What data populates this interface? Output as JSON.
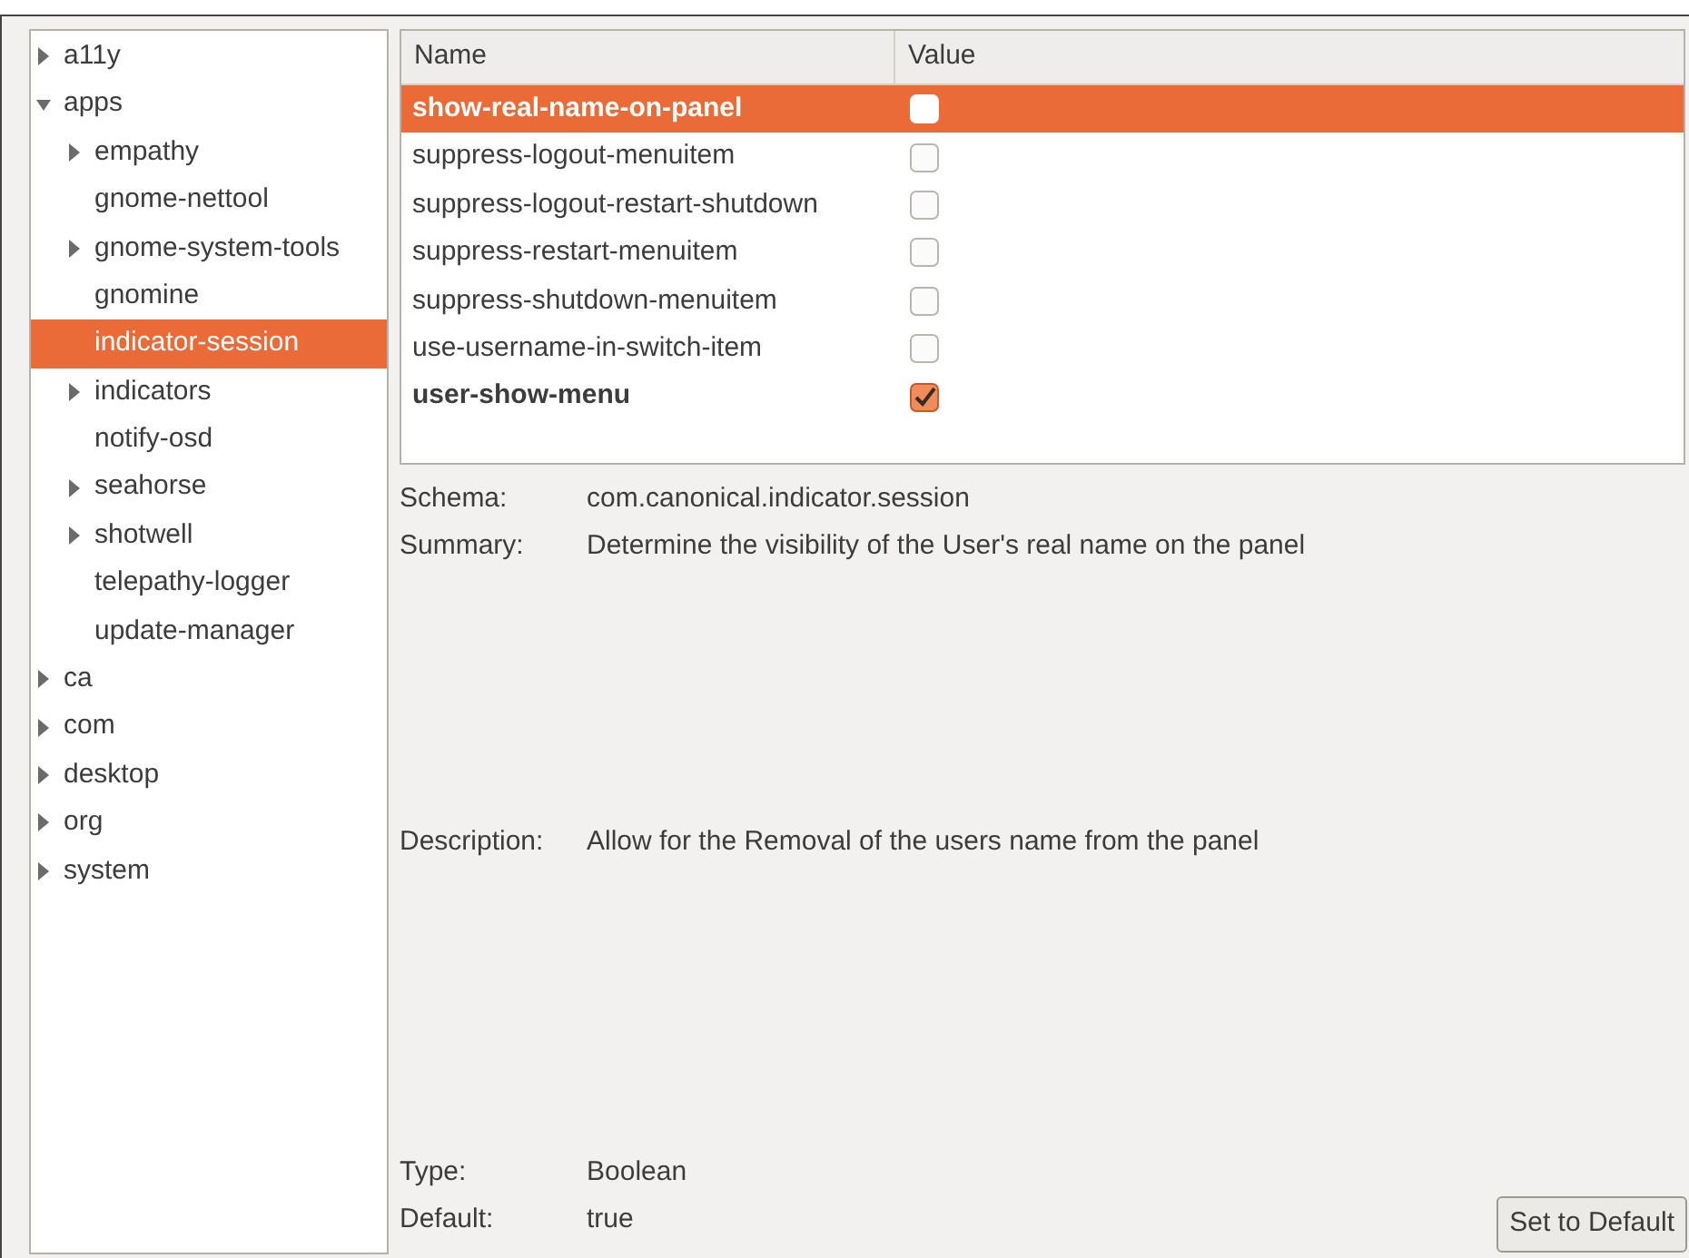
{
  "tree": [
    {
      "label": "a11y",
      "kind": "branch",
      "expanded": false,
      "selected": false
    },
    {
      "label": "apps",
      "kind": "branch",
      "expanded": true,
      "selected": false,
      "children": [
        {
          "label": "empathy",
          "kind": "branch",
          "expanded": false,
          "selected": false
        },
        {
          "label": "gnome-nettool",
          "kind": "leaf",
          "selected": false
        },
        {
          "label": "gnome-system-tools",
          "kind": "branch",
          "expanded": false,
          "selected": false
        },
        {
          "label": "gnomine",
          "kind": "leaf",
          "selected": false
        },
        {
          "label": "indicator-session",
          "kind": "leaf",
          "selected": true
        },
        {
          "label": "indicators",
          "kind": "branch",
          "expanded": false,
          "selected": false
        },
        {
          "label": "notify-osd",
          "kind": "leaf",
          "selected": false
        },
        {
          "label": "seahorse",
          "kind": "branch",
          "expanded": false,
          "selected": false
        },
        {
          "label": "shotwell",
          "kind": "branch",
          "expanded": false,
          "selected": false
        },
        {
          "label": "telepathy-logger",
          "kind": "leaf",
          "selected": false
        },
        {
          "label": "update-manager",
          "kind": "leaf",
          "selected": false
        }
      ]
    },
    {
      "label": "ca",
      "kind": "branch",
      "expanded": false,
      "selected": false
    },
    {
      "label": "com",
      "kind": "branch",
      "expanded": false,
      "selected": false
    },
    {
      "label": "desktop",
      "kind": "branch",
      "expanded": false,
      "selected": false
    },
    {
      "label": "org",
      "kind": "branch",
      "expanded": false,
      "selected": false
    },
    {
      "label": "system",
      "kind": "branch",
      "expanded": false,
      "selected": false
    }
  ],
  "table": {
    "columns": [
      "Name",
      "Value"
    ],
    "rows": [
      {
        "name": "show-real-name-on-panel",
        "checked": false,
        "modified": true,
        "selected": true
      },
      {
        "name": "suppress-logout-menuitem",
        "checked": false,
        "modified": false,
        "selected": false
      },
      {
        "name": "suppress-logout-restart-shutdown",
        "checked": false,
        "modified": false,
        "selected": false
      },
      {
        "name": "suppress-restart-menuitem",
        "checked": false,
        "modified": false,
        "selected": false
      },
      {
        "name": "suppress-shutdown-menuitem",
        "checked": false,
        "modified": false,
        "selected": false
      },
      {
        "name": "use-username-in-switch-item",
        "checked": false,
        "modified": false,
        "selected": false
      },
      {
        "name": "user-show-menu",
        "checked": true,
        "modified": true,
        "selected": false
      }
    ]
  },
  "details": [
    {
      "label": "Schema:",
      "value": "com.canonical.indicator.session"
    },
    {
      "label": "Summary:",
      "value": "Determine the visibility of the User's real name on the panel"
    },
    {
      "label": "Description:",
      "value": "Allow for the Removal of the users name from the panel"
    },
    {
      "label": "Type:",
      "value": "Boolean"
    },
    {
      "label": "Default:",
      "value": "true"
    }
  ],
  "button": "Set to Default"
}
